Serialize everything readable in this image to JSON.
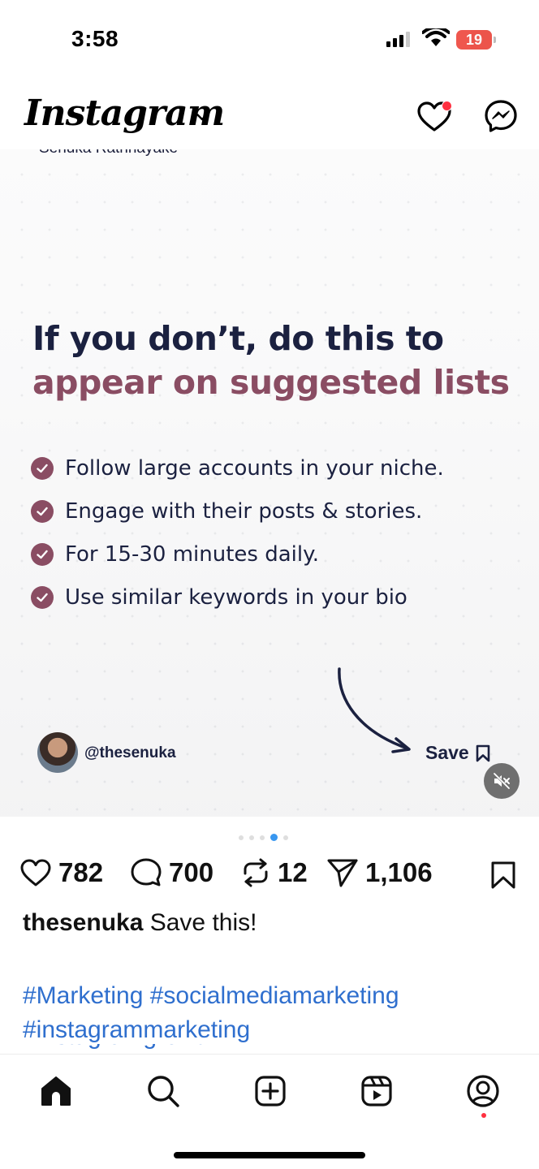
{
  "status_bar": {
    "time": "3:58",
    "battery": "19"
  },
  "header": {
    "brand": "Instagram"
  },
  "post": {
    "author_cut": "Senuka Rathnayake",
    "headline_line1": "If you don’t, do this to",
    "headline_line2": "appear on suggested lists",
    "checklist": [
      "Follow large accounts in your niche.",
      "Engage with their posts & stories.",
      "For 15-30 minutes daily.",
      "Use similar keywords in your bio"
    ],
    "handle": "@thesenuka",
    "save_label": "Save",
    "carousel": {
      "count": 5,
      "active_index": 3
    }
  },
  "actions": {
    "likes": "782",
    "comments": "700",
    "reposts": "12",
    "shares": "1,106"
  },
  "caption": {
    "username": "thesenuka",
    "text": "Save this!"
  },
  "hashtags": [
    "#Marketing #socialmediamarketing",
    "#instagrammarketing",
    "#instagramgrowth"
  ],
  "tabs": [
    "home",
    "search",
    "create",
    "reels",
    "profile"
  ],
  "colors": {
    "accent": "#8a4d63",
    "navy": "#1b2140",
    "link": "#2f6fce",
    "notification": "#ff3040"
  }
}
